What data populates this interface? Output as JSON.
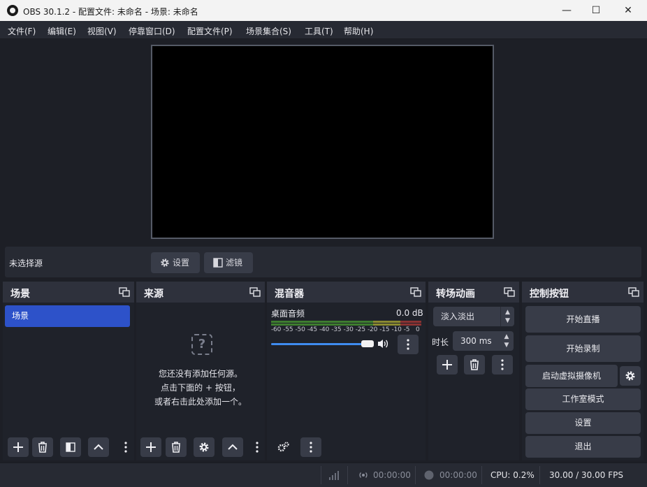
{
  "window": {
    "title": "OBS 30.1.2 - 配置文件: 未命名 - 场景: 未命名",
    "minimize_glyph": "—",
    "maximize_glyph": "☐",
    "close_glyph": "✕"
  },
  "menu": [
    "文件(F)",
    "编辑(E)",
    "视图(V)",
    "停靠窗口(D)",
    "配置文件(P)",
    "场景集合(S)",
    "工具(T)",
    "帮助(H)"
  ],
  "source_bar": {
    "no_selection": "未选择源",
    "settings_label": "设置",
    "filters_label": "滤镜"
  },
  "docks": {
    "scenes": {
      "title": "场景",
      "items": [
        "场景"
      ]
    },
    "sources": {
      "title": "来源",
      "empty_lines": [
        "您还没有添加任何源。",
        "点击下面的 + 按钮，",
        "或者右击此处添加一个。"
      ]
    },
    "mixer": {
      "title": "混音器",
      "channel_name": "桌面音频",
      "level": "0.0 dB",
      "scale": [
        "-60",
        "-55",
        "-50",
        "-45",
        "-40",
        "-35",
        "-30",
        "-25",
        "-20",
        "-15",
        "-10",
        "-5",
        "0"
      ],
      "volume_fraction": 0.9
    },
    "transitions": {
      "title": "转场动画",
      "transition": "淡入淡出",
      "duration_label": "时长",
      "duration": "300 ms"
    },
    "controls": {
      "title": "控制按钮",
      "start_streaming": "开始直播",
      "start_recording": "开始录制",
      "start_virtual_cam": "启动虚拟摄像机",
      "studio_mode": "工作室模式",
      "settings": "设置",
      "exit": "退出"
    }
  },
  "status": {
    "stream_time": "00:00:00",
    "record_time": "00:00:00",
    "cpu": "CPU: 0.2%",
    "fps": "30.00 / 30.00 FPS"
  },
  "colors": {
    "accent": "#2d52c9",
    "slider": "#3f8cf0",
    "meter_green": "#4e9a3a",
    "meter_yellow": "#9a9a3a",
    "meter_red": "#9a3a3a"
  }
}
